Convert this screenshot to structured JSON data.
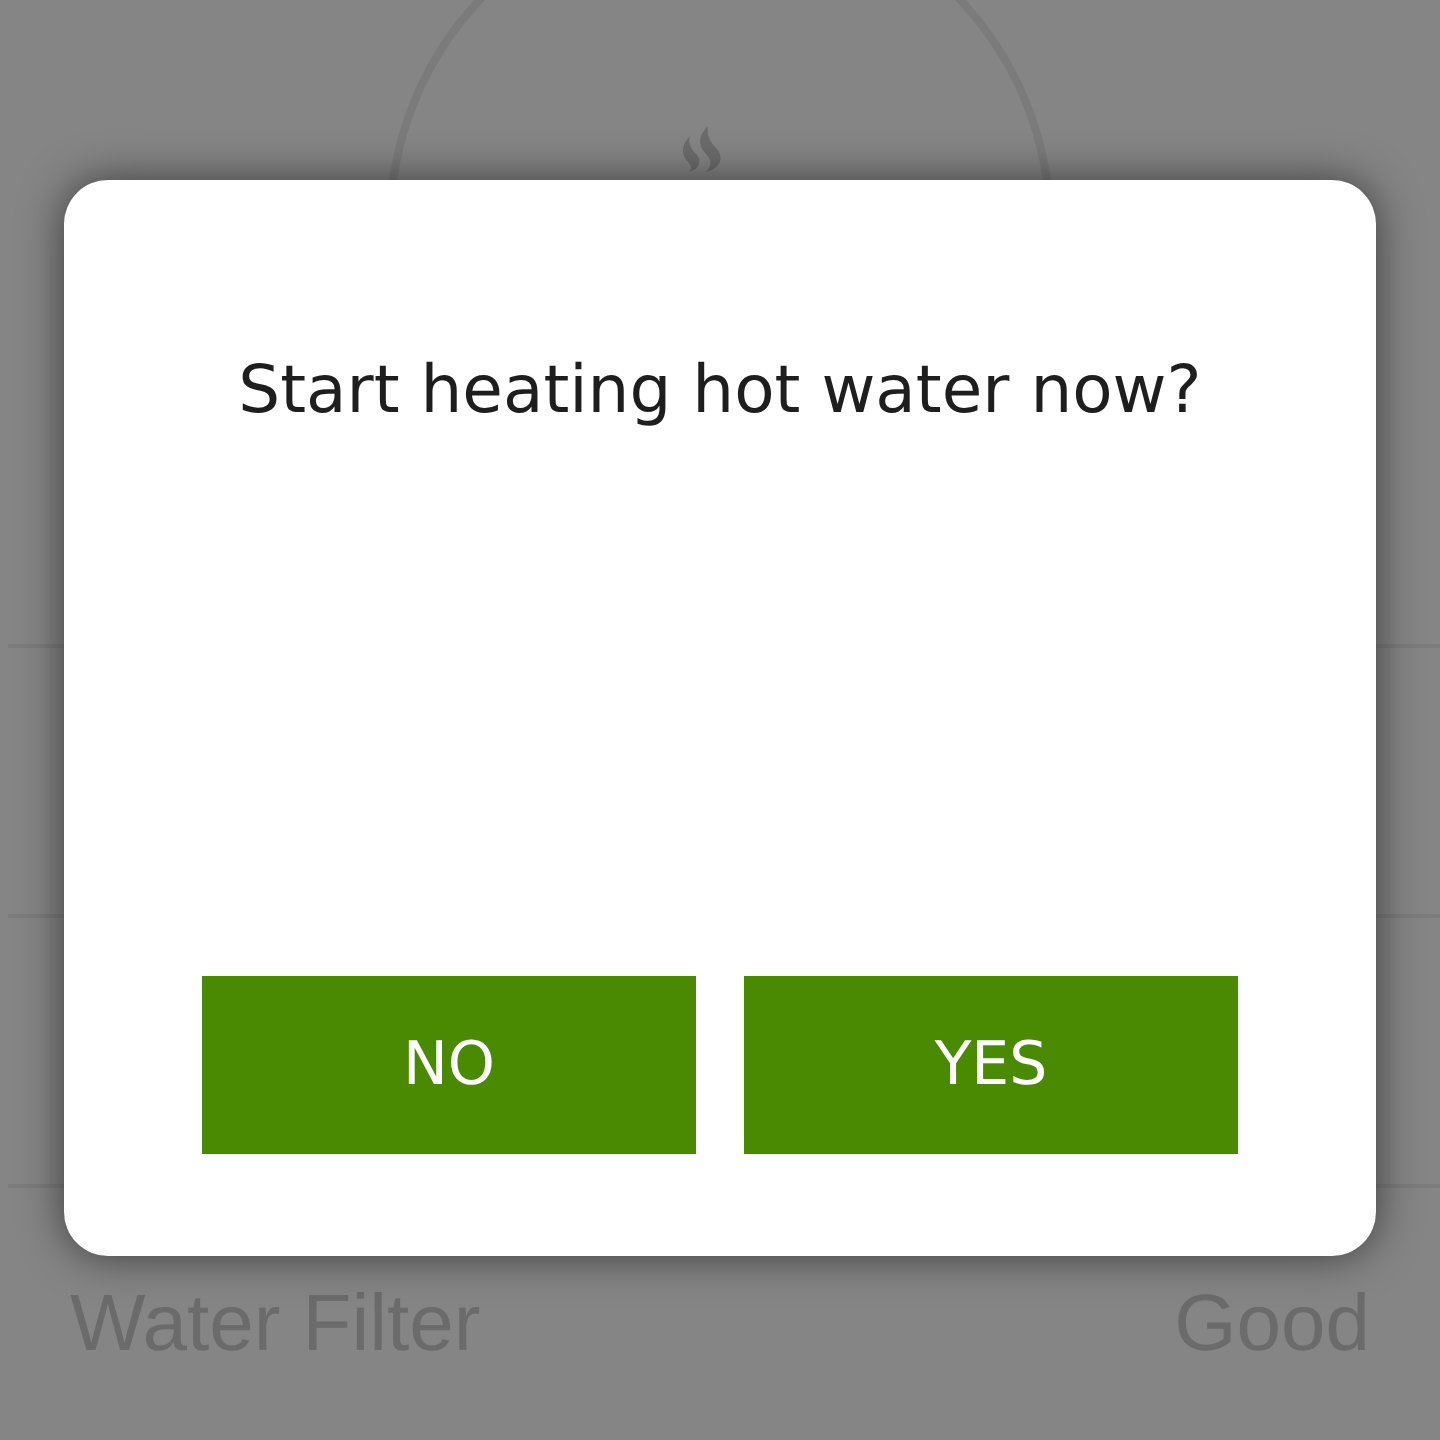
{
  "background": {
    "rows": [
      {
        "label": "Water Filter",
        "value": "Good"
      }
    ]
  },
  "dialog": {
    "message": "Start heating hot water now?",
    "buttons": [
      {
        "label": "NO"
      },
      {
        "label": "YES"
      }
    ]
  }
}
